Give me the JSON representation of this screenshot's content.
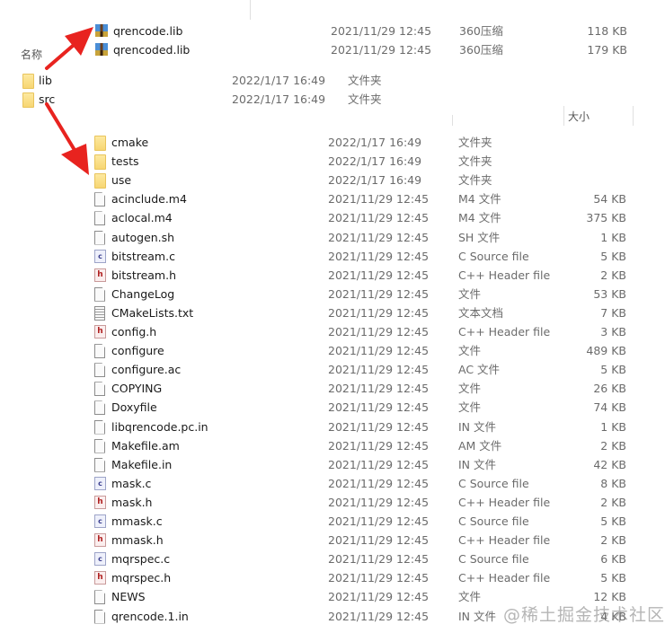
{
  "top_panel": {
    "files": [
      {
        "name": "qrencode.lib",
        "date": "2021/11/29 12:45",
        "type": "360压缩",
        "size": "118 KB",
        "icon": "archive-icon"
      },
      {
        "name": "qrencoded.lib",
        "date": "2021/11/29 12:45",
        "type": "360压缩",
        "size": "179 KB",
        "icon": "archive-icon"
      }
    ]
  },
  "left_panel": {
    "header_name": "名称",
    "folders": [
      {
        "name": "lib",
        "date": "2022/1/17 16:49",
        "type": "文件夹"
      },
      {
        "name": "src",
        "date": "2022/1/17 16:49",
        "type": "文件夹"
      }
    ]
  },
  "main_panel": {
    "header_size": "大小",
    "files": [
      {
        "name": "cmake",
        "date": "2022/1/17 16:49",
        "type": "文件夹",
        "size": "",
        "icon": "folder"
      },
      {
        "name": "tests",
        "date": "2022/1/17 16:49",
        "type": "文件夹",
        "size": "",
        "icon": "folder"
      },
      {
        "name": "use",
        "date": "2022/1/17 16:49",
        "type": "文件夹",
        "size": "",
        "icon": "folder"
      },
      {
        "name": "acinclude.m4",
        "date": "2021/11/29 12:45",
        "type": "M4 文件",
        "size": "54 KB",
        "icon": "doc"
      },
      {
        "name": "aclocal.m4",
        "date": "2021/11/29 12:45",
        "type": "M4 文件",
        "size": "375 KB",
        "icon": "doc"
      },
      {
        "name": "autogen.sh",
        "date": "2021/11/29 12:45",
        "type": "SH 文件",
        "size": "1 KB",
        "icon": "doc"
      },
      {
        "name": "bitstream.c",
        "date": "2021/11/29 12:45",
        "type": "C Source file",
        "size": "5 KB",
        "icon": "c"
      },
      {
        "name": "bitstream.h",
        "date": "2021/11/29 12:45",
        "type": "C++ Header file",
        "size": "2 KB",
        "icon": "h"
      },
      {
        "name": "ChangeLog",
        "date": "2021/11/29 12:45",
        "type": "文件",
        "size": "53 KB",
        "icon": "doc"
      },
      {
        "name": "CMakeLists.txt",
        "date": "2021/11/29 12:45",
        "type": "文本文档",
        "size": "7 KB",
        "icon": "txt"
      },
      {
        "name": "config.h",
        "date": "2021/11/29 12:45",
        "type": "C++ Header file",
        "size": "3 KB",
        "icon": "h"
      },
      {
        "name": "configure",
        "date": "2021/11/29 12:45",
        "type": "文件",
        "size": "489 KB",
        "icon": "doc"
      },
      {
        "name": "configure.ac",
        "date": "2021/11/29 12:45",
        "type": "AC 文件",
        "size": "5 KB",
        "icon": "doc"
      },
      {
        "name": "COPYING",
        "date": "2021/11/29 12:45",
        "type": "文件",
        "size": "26 KB",
        "icon": "doc"
      },
      {
        "name": "Doxyfile",
        "date": "2021/11/29 12:45",
        "type": "文件",
        "size": "74 KB",
        "icon": "doc"
      },
      {
        "name": "libqrencode.pc.in",
        "date": "2021/11/29 12:45",
        "type": "IN 文件",
        "size": "1 KB",
        "icon": "doc"
      },
      {
        "name": "Makefile.am",
        "date": "2021/11/29 12:45",
        "type": "AM 文件",
        "size": "2 KB",
        "icon": "doc"
      },
      {
        "name": "Makefile.in",
        "date": "2021/11/29 12:45",
        "type": "IN 文件",
        "size": "42 KB",
        "icon": "doc"
      },
      {
        "name": "mask.c",
        "date": "2021/11/29 12:45",
        "type": "C Source file",
        "size": "8 KB",
        "icon": "c"
      },
      {
        "name": "mask.h",
        "date": "2021/11/29 12:45",
        "type": "C++ Header file",
        "size": "2 KB",
        "icon": "h"
      },
      {
        "name": "mmask.c",
        "date": "2021/11/29 12:45",
        "type": "C Source file",
        "size": "5 KB",
        "icon": "c"
      },
      {
        "name": "mmask.h",
        "date": "2021/11/29 12:45",
        "type": "C++ Header file",
        "size": "2 KB",
        "icon": "h"
      },
      {
        "name": "mqrspec.c",
        "date": "2021/11/29 12:45",
        "type": "C Source file",
        "size": "6 KB",
        "icon": "c"
      },
      {
        "name": "mqrspec.h",
        "date": "2021/11/29 12:45",
        "type": "C++ Header file",
        "size": "5 KB",
        "icon": "h"
      },
      {
        "name": "NEWS",
        "date": "2021/11/29 12:45",
        "type": "文件",
        "size": "12 KB",
        "icon": "doc"
      },
      {
        "name": "qrencode.1.in",
        "date": "2021/11/29 12:45",
        "type": "IN 文件",
        "size": "4 KB",
        "icon": "doc"
      }
    ]
  },
  "annotation_color": "#e8231f",
  "watermark": "@稀土掘金技术社区"
}
